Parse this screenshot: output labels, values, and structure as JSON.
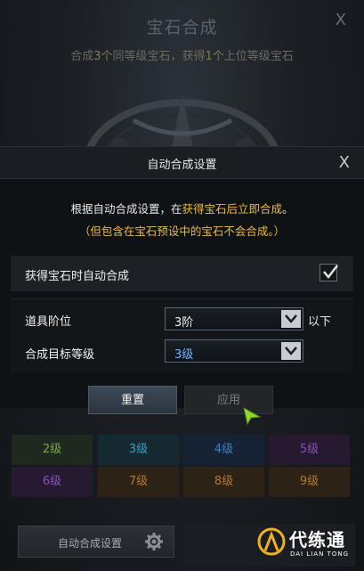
{
  "background": {
    "title": "宝石合成",
    "close_label": "X",
    "subtitle": {
      "parts": [
        "合成",
        "3个",
        "同等级宝石，获得",
        "1个",
        "上位等级宝石"
      ]
    }
  },
  "dialog": {
    "title": "自动合成设置",
    "close_label": "X",
    "description": {
      "before": "根据自动合成设置，在",
      "highlight": "获得宝石后立即合成",
      "after": "。"
    },
    "note": "（但包含在宝石预设中的宝石不会合成。）",
    "auto_combine": {
      "label": "获得宝石时自动合成",
      "checked": true
    },
    "item_tier": {
      "label": "道具阶位",
      "value": "3阶",
      "suffix": "以下"
    },
    "target_level": {
      "label": "合成目标等级",
      "value": "3级"
    }
  },
  "buttons": {
    "reset": "重置",
    "apply": "应用"
  },
  "grades": [
    {
      "label": "2级",
      "color": "#7ea64a",
      "bg": "#1e2a1f"
    },
    {
      "label": "3级",
      "color": "#3a9fc4",
      "bg": "#152a30"
    },
    {
      "label": "4级",
      "color": "#3e7fc9",
      "bg": "#162334"
    },
    {
      "label": "5级",
      "color": "#8a4fb8",
      "bg": "#261a31"
    },
    {
      "label": "6级",
      "color": "#8a4fb8",
      "bg": "#261a31"
    },
    {
      "label": "7级",
      "color": "#b57a2c",
      "bg": "#2c2216"
    },
    {
      "label": "8级",
      "color": "#b57a2c",
      "bg": "#2c2216"
    },
    {
      "label": "9级",
      "color": "#b57a2c",
      "bg": "#2c2216"
    }
  ],
  "bottom": {
    "auto_settings_label": "自动合成设置"
  },
  "watermark": {
    "title": "代练通",
    "subtitle": "DAI LIAN TONG"
  }
}
